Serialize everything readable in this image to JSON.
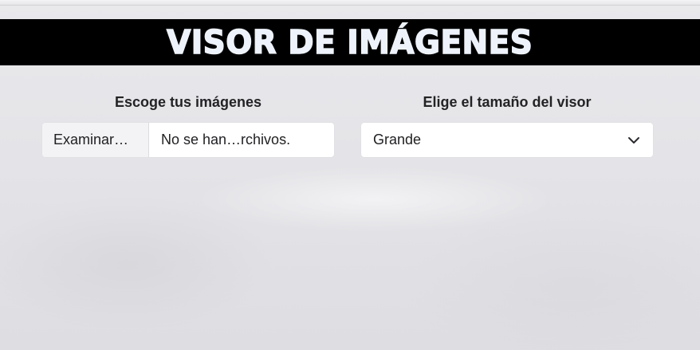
{
  "header": {
    "title": "VISOR DE IMÁGENES"
  },
  "image_picker": {
    "label": "Escoge tus imágenes",
    "browse_label": "Examinar…",
    "status_text": "No se han…rchivos."
  },
  "viewer_size": {
    "label": "Elige el tamaño del visor",
    "selected": "Grande",
    "icon": "chevron-down-icon"
  },
  "colors": {
    "title_bar": "#000000",
    "title_text": "#eef3fb",
    "page_background": "#e6e6e9",
    "control_background": "#ffffff"
  }
}
